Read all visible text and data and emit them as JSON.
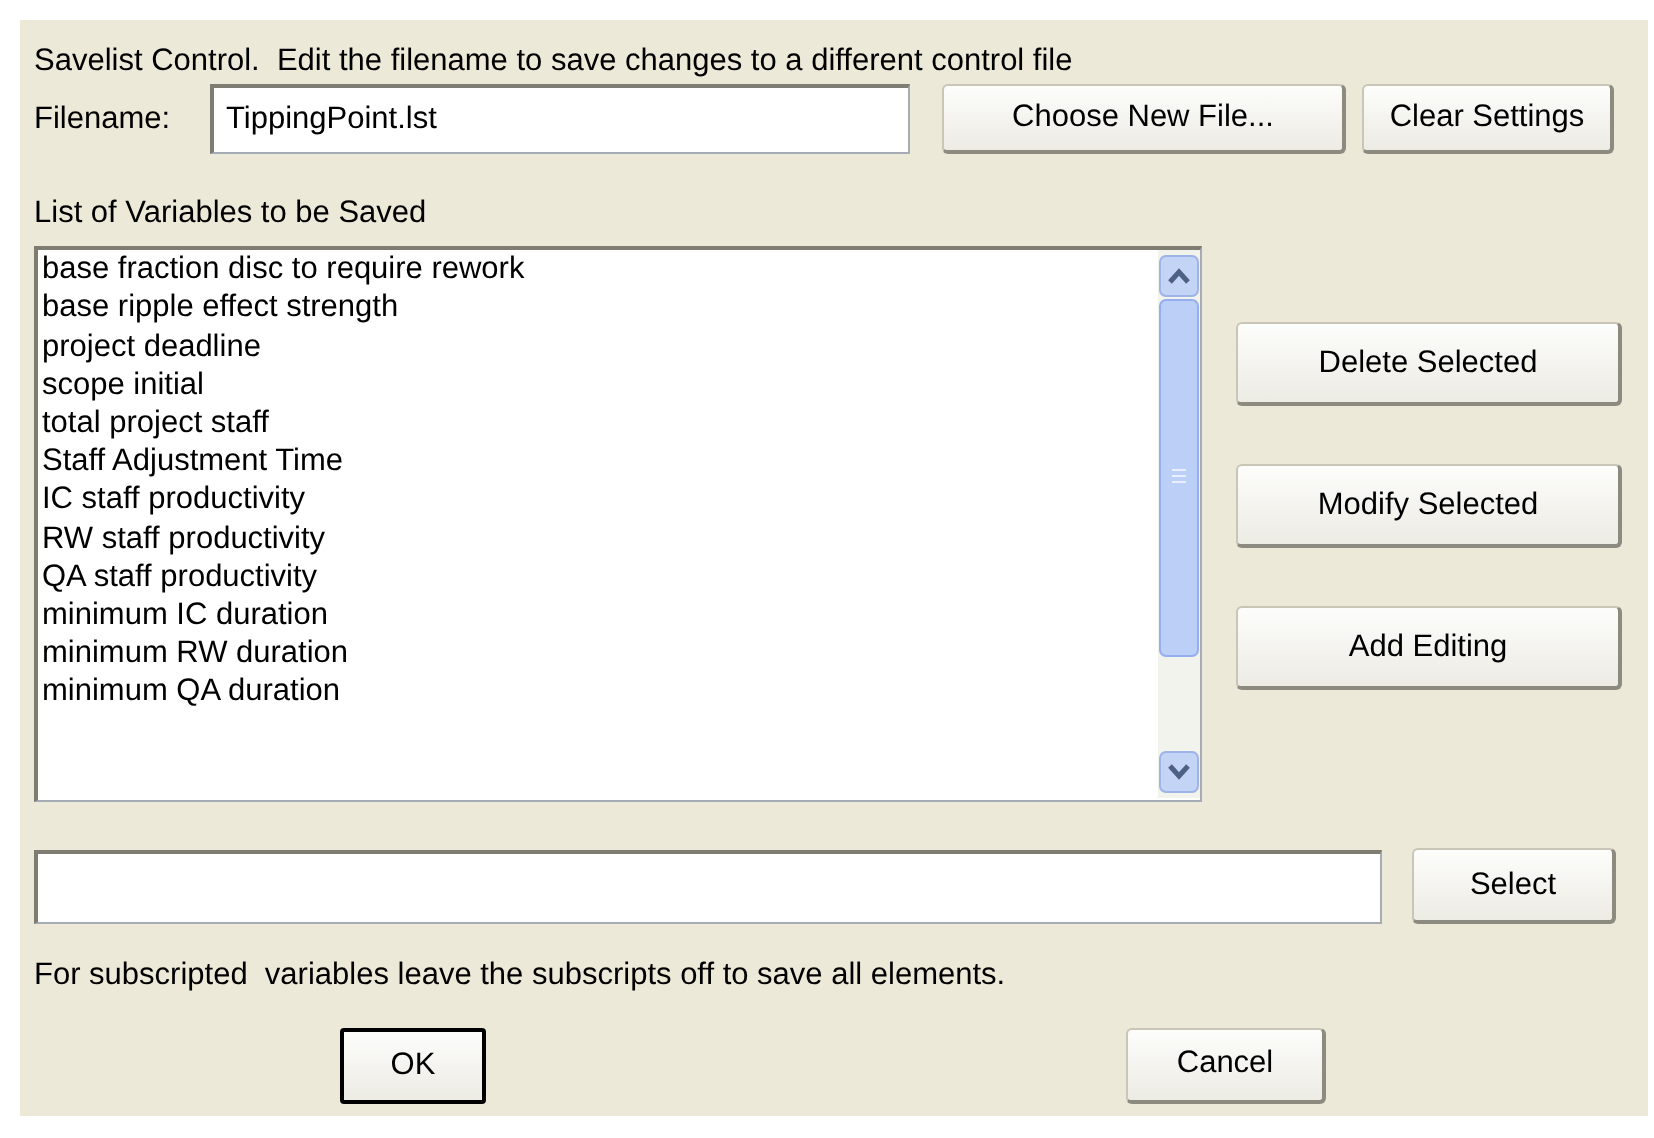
{
  "heading": "Savelist Control.  Edit the filename to save changes to a different control file",
  "filename": {
    "label": "Filename:",
    "value": "TippingPoint.lst"
  },
  "file_buttons": [
    "Choose New File...",
    "Clear Settings"
  ],
  "list_label": "List of Variables to be Saved",
  "variables": [
    "base fraction disc to require rework",
    "base ripple effect strength",
    "project deadline",
    "scope initial",
    "total project staff",
    "Staff Adjustment Time",
    "IC staff productivity",
    "RW staff productivity",
    "QA staff productivity",
    "minimum IC duration",
    "minimum RW duration",
    "minimum QA duration"
  ],
  "side_buttons": [
    "Delete Selected",
    "Modify Selected",
    "Add Editing"
  ],
  "select_field": {
    "button": "Select"
  },
  "note": "For subscripted  variables leave the subscripts off to save all elements.",
  "dialog_buttons": [
    {
      "label": "OK",
      "default": true
    },
    {
      "label": "Cancel",
      "default": false
    }
  ]
}
